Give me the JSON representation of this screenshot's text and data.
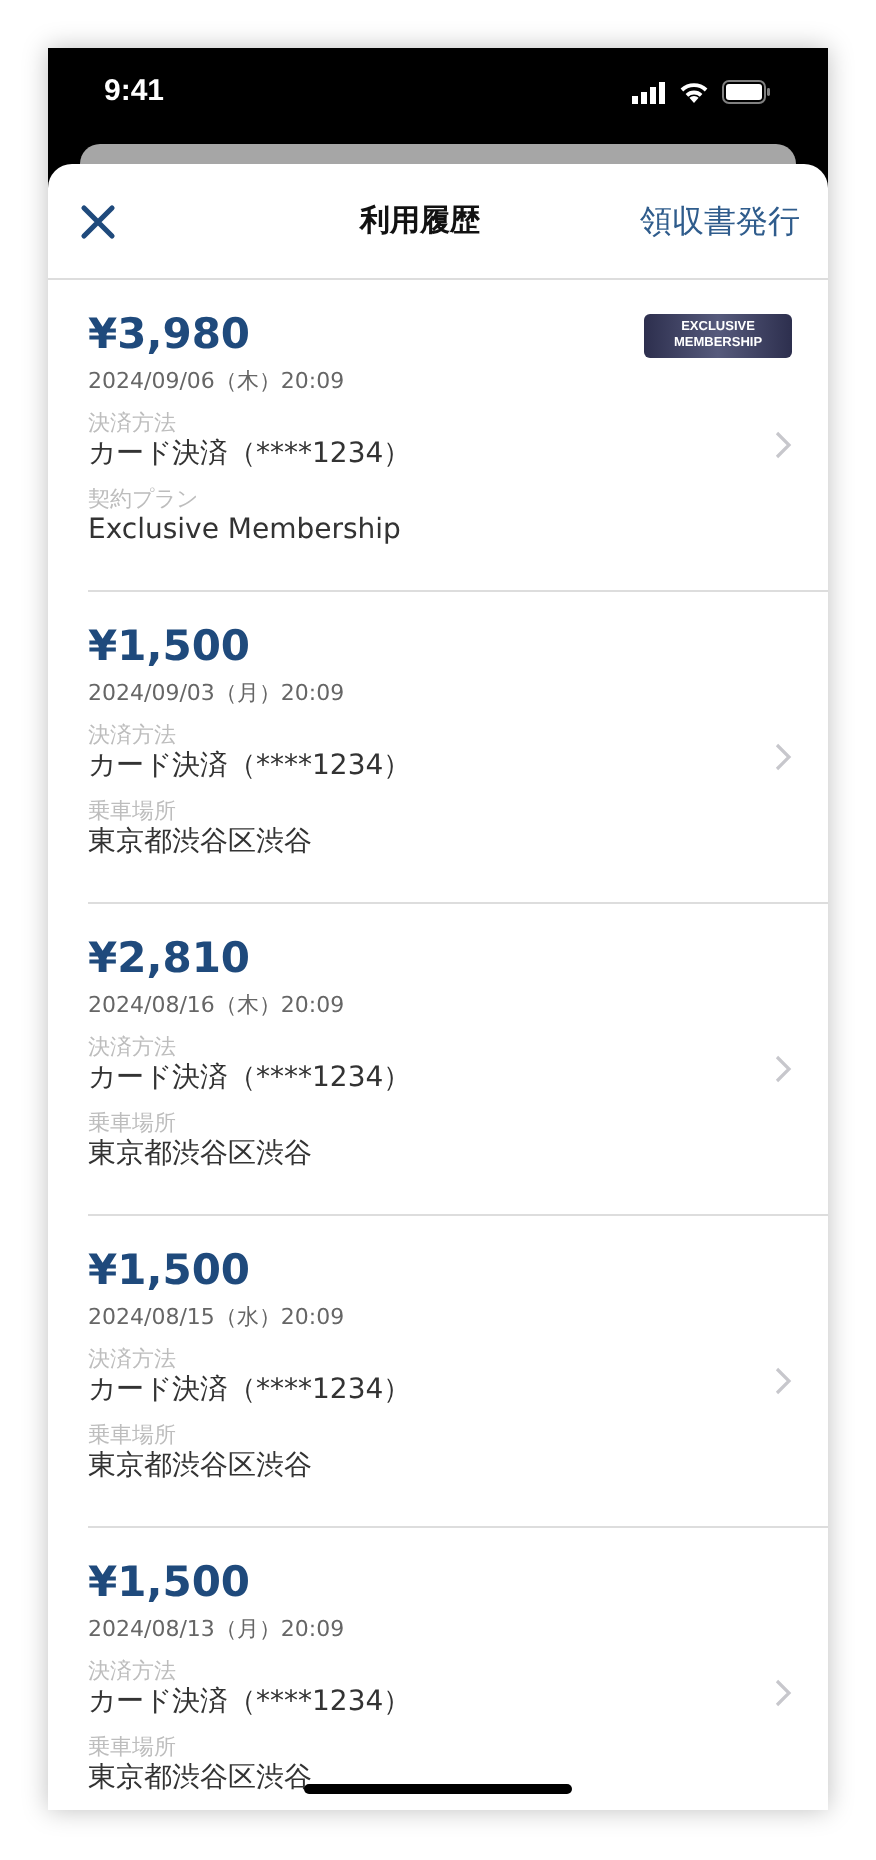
{
  "status_bar": {
    "time": "9:41"
  },
  "header": {
    "title": "利用履歴",
    "action": "領収書発行"
  },
  "items": [
    {
      "amount": "¥3,980",
      "datetime": "2024/09/06（木）20:09",
      "badge": [
        "EXCLUSIVE",
        "MEMBERSHIP"
      ],
      "fields": [
        {
          "label": "決済方法",
          "value": "カード決済（****1234）"
        },
        {
          "label": "契約プラン",
          "value": "Exclusive Membership"
        }
      ]
    },
    {
      "amount": "¥1,500",
      "datetime": "2024/09/03（月）20:09",
      "fields": [
        {
          "label": "決済方法",
          "value": "カード決済（****1234）"
        },
        {
          "label": "乗車場所",
          "value": "東京都渋谷区渋谷"
        }
      ]
    },
    {
      "amount": "¥2,810",
      "datetime": "2024/08/16（木）20:09",
      "fields": [
        {
          "label": "決済方法",
          "value": "カード決済（****1234）"
        },
        {
          "label": "乗車場所",
          "value": "東京都渋谷区渋谷"
        }
      ]
    },
    {
      "amount": "¥1,500",
      "datetime": "2024/08/15（水）20:09",
      "fields": [
        {
          "label": "決済方法",
          "value": "カード決済（****1234）"
        },
        {
          "label": "乗車場所",
          "value": "東京都渋谷区渋谷"
        }
      ]
    },
    {
      "amount": "¥1,500",
      "datetime": "2024/08/13（月）20:09",
      "fields": [
        {
          "label": "決済方法",
          "value": "カード決済（****1234）"
        },
        {
          "label": "乗車場所",
          "value": "東京都渋谷区渋谷"
        }
      ]
    }
  ]
}
